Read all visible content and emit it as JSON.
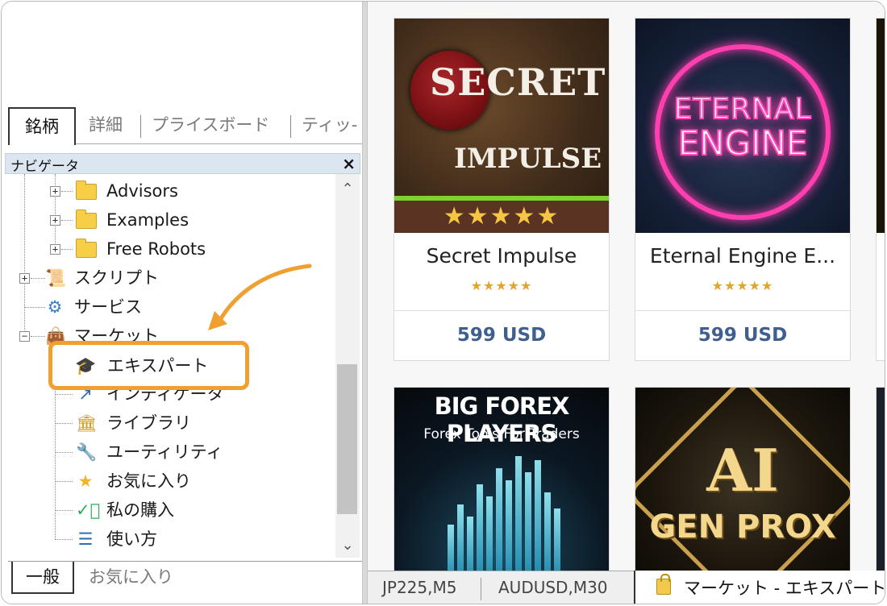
{
  "top_tabs": [
    "銘柄",
    "詳細",
    "プライスボード",
    "ティッ-"
  ],
  "navigator": {
    "title": "ナビゲータ",
    "close_glyph": "×",
    "items": [
      {
        "label": "Advisors",
        "icon": "folder-icon"
      },
      {
        "label": "Examples",
        "icon": "folder-icon"
      },
      {
        "label": "Free Robots",
        "icon": "folder-icon"
      },
      {
        "label": "スクリプト",
        "icon": "script-icon"
      },
      {
        "label": "サービス",
        "icon": "service-icon"
      },
      {
        "label": "マーケット",
        "icon": "market-bag-icon"
      },
      {
        "label": "エキスパート",
        "icon": "graduation-cap-icon"
      },
      {
        "label": "インディケータ",
        "icon": "indicator-icon"
      },
      {
        "label": "ライブラリ",
        "icon": "library-icon"
      },
      {
        "label": "ユーティリティ",
        "icon": "wrench-icon"
      },
      {
        "label": "お気に入り",
        "icon": "star-icon"
      },
      {
        "label": "私の購入",
        "icon": "check-circle-icon"
      },
      {
        "label": "使い方",
        "icon": "list-icon"
      }
    ]
  },
  "bottom_tabs": [
    "一般",
    "お気に入り"
  ],
  "market": {
    "products": [
      {
        "name": "Secret Impulse",
        "price": "599 USD",
        "rating": "★★★★★",
        "art_title": "SECRET",
        "art_subtitle": "IMPULSE",
        "art_rating": "★★★★★"
      },
      {
        "name": "Eternal Engine E...",
        "price": "599 USD",
        "rating": "★★★★★",
        "art_title": "ETERNAL",
        "art_subtitle": "ENGINE"
      },
      {
        "name": "",
        "price": "",
        "rating": "",
        "art_title": "BIG FOREX PLAYERS",
        "art_subtitle": "Forex Tools For Traders"
      },
      {
        "name": "",
        "price": "",
        "rating": "",
        "art_title": "AI",
        "art_subtitle": "GEN PROX"
      }
    ]
  },
  "chart_tabs": [
    "JP225,M5",
    "AUDUSD,M30"
  ],
  "active_tab": "マーケット - エキスパート",
  "colors": {
    "highlight": "#f0a031",
    "price": "#3f5f8f",
    "stars": "#e2a52a",
    "navigator_header": "#dbe6f1"
  }
}
